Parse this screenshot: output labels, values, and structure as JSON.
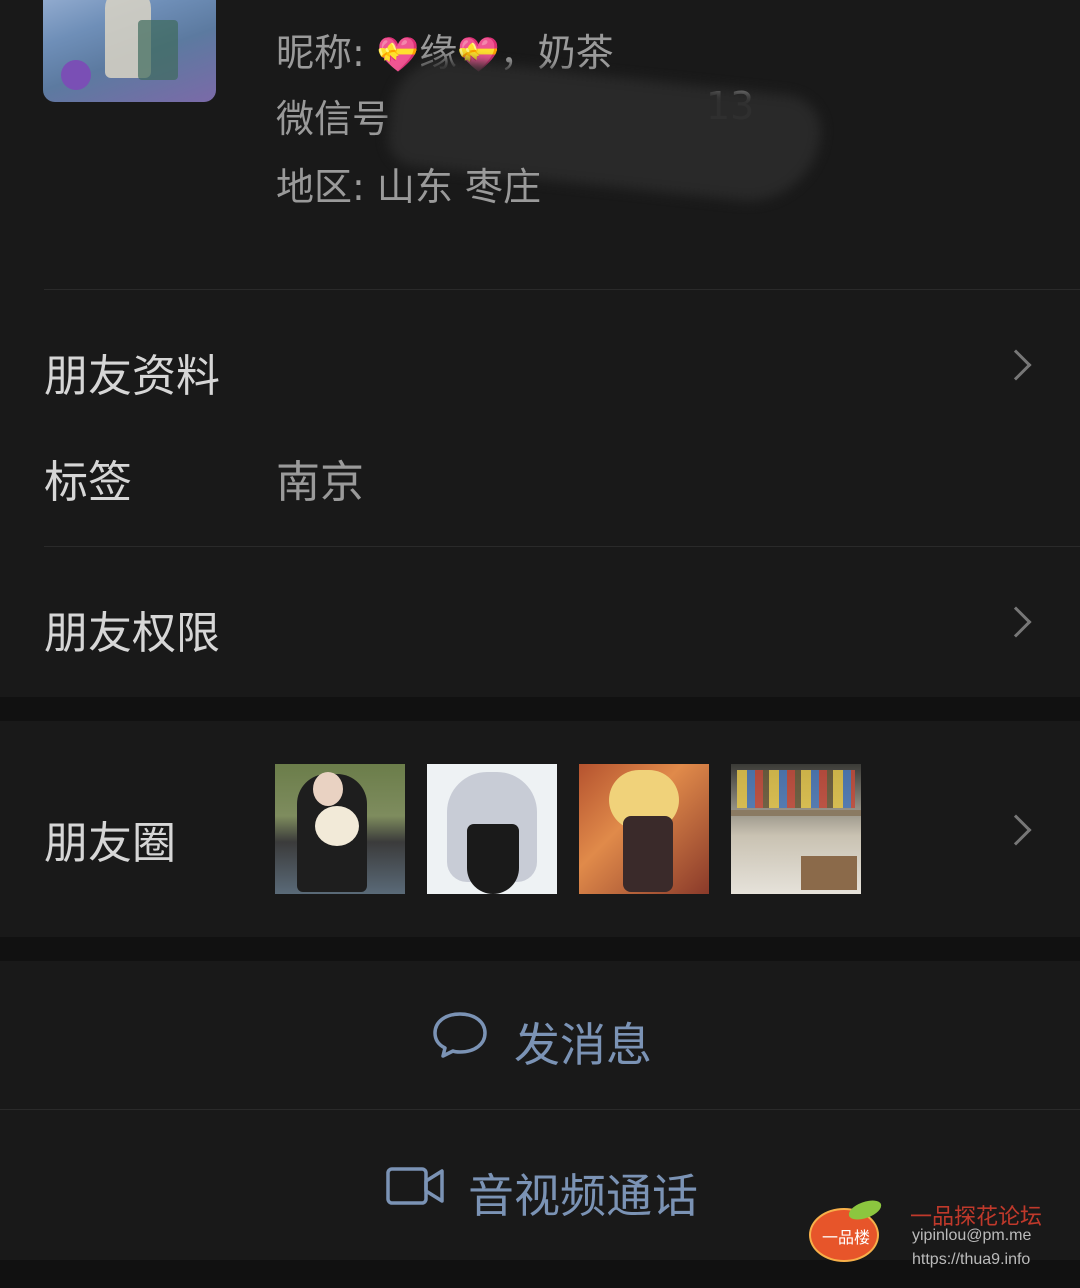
{
  "profile": {
    "nickname_label": "昵称:",
    "nickname_heart_1": "💝",
    "nickname_mid": "缘",
    "nickname_heart_2": "💝",
    "nickname_rest": "，奶茶",
    "wechat_id_label": "微信号",
    "wechat_id_tail": "13",
    "region_label": "地区:",
    "region_value": "山东  枣庄"
  },
  "rows": {
    "friend_info": "朋友资料",
    "tag_label": "标签",
    "tag_value": "南京",
    "permissions": "朋友权限",
    "moments": "朋友圈"
  },
  "actions": {
    "send_message": "发消息",
    "video_call": "音视频通话"
  },
  "watermark": {
    "logo_text": "一品楼",
    "title": "一品探花论坛",
    "email": "yipinlou@pm.me",
    "url": "https://thua9.info"
  },
  "colors": {
    "background": "#191919",
    "section_gap": "#111111",
    "action_accent": "#7b93b5"
  }
}
